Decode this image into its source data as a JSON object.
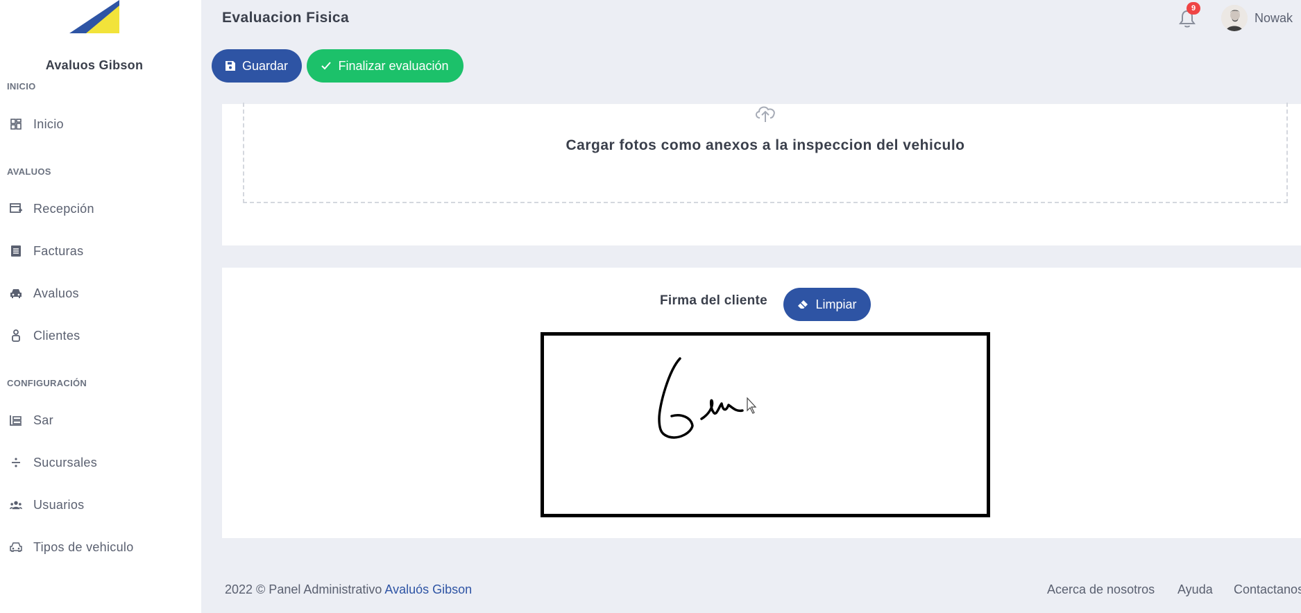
{
  "sidebar": {
    "brand": "Avaluos Gibson",
    "sections": {
      "inicio": "INICIO",
      "avaluos": "AVALUOS",
      "configuracion": "CONFIGURACIÓN"
    },
    "items": [
      {
        "label": "Inicio",
        "icon": "dashboard-icon"
      },
      {
        "label": "Recepción",
        "icon": "reception-icon"
      },
      {
        "label": "Facturas",
        "icon": "invoice-icon"
      },
      {
        "label": "Avaluos",
        "icon": "car-icon"
      },
      {
        "label": "Clientes",
        "icon": "person-icon"
      },
      {
        "label": "Sar",
        "icon": "register-icon"
      },
      {
        "label": "Sucursales",
        "icon": "divide-icon"
      },
      {
        "label": "Usuarios",
        "icon": "users-icon"
      },
      {
        "label": "Tipos de vehiculo",
        "icon": "vehicle-icon"
      }
    ]
  },
  "header": {
    "title": "Evaluacion Fisica",
    "notification_count": "9",
    "username": "Nowak"
  },
  "actions": {
    "save_label": "Guardar",
    "finish_label": "Finalizar evaluación"
  },
  "upload": {
    "text": "Cargar fotos como anexos a la inspeccion del vehiculo"
  },
  "signature": {
    "label": "Firma del cliente",
    "clear_label": "Limpiar"
  },
  "footer": {
    "copyright": "2022 © Panel Administrativo ",
    "brand_link": "Avaluós Gibson",
    "links": [
      "Acerca de nosotros",
      "Ayuda",
      "Contactanos"
    ]
  },
  "colors": {
    "primary": "#2e54a4",
    "success": "#1cc16a",
    "badge": "#ef4444",
    "background": "#eceef4"
  }
}
